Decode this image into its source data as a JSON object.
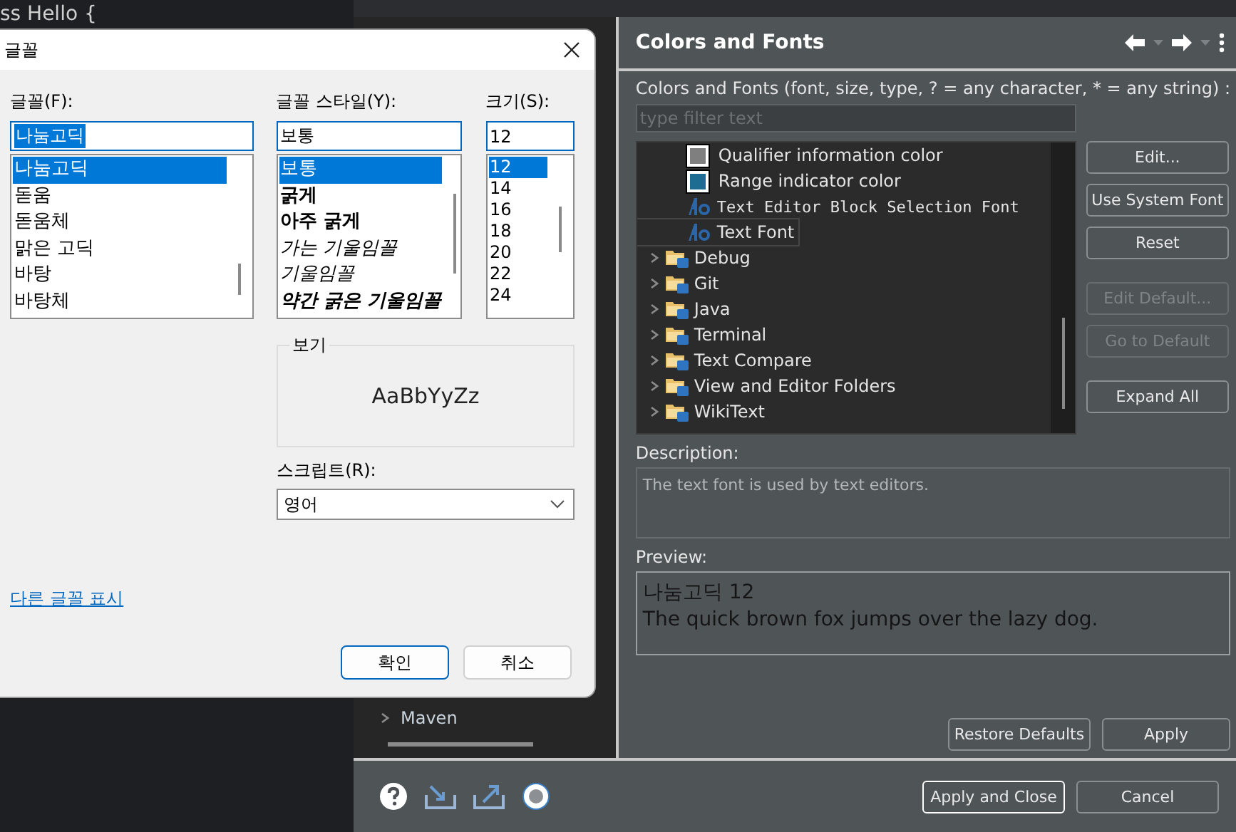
{
  "editor": {
    "code_fragment": "ss Hello {"
  },
  "preferences": {
    "nav_items": [
      {
        "label": "Maven",
        "expanded": false
      }
    ],
    "page_title": "Colors and Fonts",
    "filter_label": "Colors and Fonts (font, size, type, ? = any character, * = any string) :",
    "filter": {
      "placeholder": "type filter text"
    },
    "tree": [
      {
        "kind": "color",
        "label": "Qualifier information color",
        "color": "#7f7f7f",
        "selected": false
      },
      {
        "kind": "color",
        "label": "Range indicator color",
        "color": "#1d6c91",
        "selected": false
      },
      {
        "kind": "font",
        "label": "Text Editor Block Selection Font",
        "monospace": true,
        "selected": false
      },
      {
        "kind": "font",
        "label": "Text Font",
        "monospace": false,
        "selected": true
      },
      {
        "kind": "folder",
        "label": "Debug",
        "expanded": false,
        "selected": false
      },
      {
        "kind": "folder",
        "label": "Git",
        "expanded": false,
        "selected": false
      },
      {
        "kind": "folder",
        "label": "Java",
        "expanded": false,
        "selected": false
      },
      {
        "kind": "folder",
        "label": "Terminal",
        "expanded": false,
        "selected": false
      },
      {
        "kind": "folder",
        "label": "Text Compare",
        "expanded": false,
        "selected": false
      },
      {
        "kind": "folder",
        "label": "View and Editor Folders",
        "expanded": false,
        "selected": false
      },
      {
        "kind": "folder",
        "label": "WikiText",
        "expanded": false,
        "selected": false
      }
    ],
    "side_button_groups": [
      [
        {
          "label": "Edit...",
          "disabled": false
        },
        {
          "label": "Use System Font",
          "disabled": false
        },
        {
          "label": "Reset",
          "disabled": false
        }
      ],
      [
        {
          "label": "Edit Default...",
          "disabled": true
        },
        {
          "label": "Go to Default",
          "disabled": true
        }
      ],
      [
        {
          "label": "Expand All",
          "disabled": false
        }
      ]
    ],
    "description_label": "Description:",
    "description": "The text font is used by text editors.",
    "preview_label": "Preview:",
    "preview_lines": [
      "나눔고딕 12",
      "The quick brown fox jumps over the lazy dog."
    ],
    "page_buttons": [
      "Restore Defaults",
      "Apply"
    ],
    "dialog_buttons": [
      {
        "label": "Apply and Close",
        "default": true
      },
      {
        "label": "Cancel",
        "default": false
      }
    ]
  },
  "font_dialog": {
    "title": "글꼴",
    "font": {
      "label": "글꼴(F):",
      "value": "나눔고딕",
      "items": [
        {
          "label": "나눔고딕",
          "selected": true
        },
        {
          "label": "돋움",
          "selected": false
        },
        {
          "label": "돋움체",
          "selected": false
        },
        {
          "label": "맑은 고딕",
          "selected": false
        },
        {
          "label": "바탕",
          "selected": false
        },
        {
          "label": "바탕체",
          "selected": false
        }
      ]
    },
    "style": {
      "label": "글꼴 스타일(Y):",
      "value": "보통",
      "items": [
        {
          "label": "보통",
          "kind": "regular",
          "selected": true
        },
        {
          "label": "굵게",
          "kind": "bold",
          "selected": false
        },
        {
          "label": "아주 굵게",
          "kind": "heavy",
          "selected": false
        },
        {
          "label": "가는 기울임꼴",
          "kind": "light-italic",
          "selected": false
        },
        {
          "label": "기울임꼴",
          "kind": "italic",
          "selected": false
        },
        {
          "label": "약간 굵은 기울임꼴",
          "kind": "bold-italic",
          "selected": false
        }
      ]
    },
    "size": {
      "label": "크기(S):",
      "value": "12",
      "items": [
        {
          "label": "12",
          "selected": true
        },
        {
          "label": "14",
          "selected": false
        },
        {
          "label": "16",
          "selected": false
        },
        {
          "label": "18",
          "selected": false
        },
        {
          "label": "20",
          "selected": false
        },
        {
          "label": "22",
          "selected": false
        },
        {
          "label": "24",
          "selected": false
        }
      ]
    },
    "sample_label": "보기",
    "sample": "AaBbYyZz",
    "script_label": "스크립트(R):",
    "script_value": "영어",
    "more_fonts_link": "다른 글꼴 표시",
    "buttons": [
      {
        "label": "확인",
        "default": true
      },
      {
        "label": "취소",
        "default": false
      }
    ]
  }
}
